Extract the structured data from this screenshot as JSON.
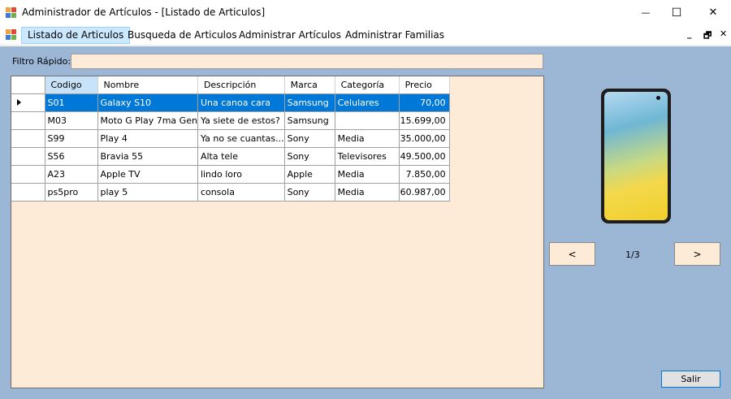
{
  "window": {
    "title": "Administrador de Artículos - [Listado de Articulos]",
    "minimize_glyph": "—",
    "maximize_glyph": "☐",
    "close_glyph": "✕"
  },
  "menu": {
    "items": [
      "Listado de Articulos",
      "Busqueda de Articulos",
      "Administrar Artículos",
      "Administrar Familias"
    ],
    "active_index": 0,
    "mdi_minimize": "_",
    "mdi_restore": "🗗",
    "mdi_close": "✕"
  },
  "filter": {
    "label": "Filtro Rápido:",
    "value": ""
  },
  "grid": {
    "columns": [
      "Codigo",
      "Nombre",
      "Descripción",
      "Marca",
      "Categoría",
      "Precio"
    ],
    "sorted_column": "Codigo",
    "rows": [
      [
        "S01",
        "Galaxy S10",
        "Una canoa cara",
        "Samsung",
        "Celulares",
        "70,00"
      ],
      [
        "M03",
        "Moto G Play 7ma Gen",
        "Ya siete de estos?",
        "Samsung",
        "",
        "15.699,00"
      ],
      [
        "S99",
        "Play 4",
        "Ya no se cuantas...",
        "Sony",
        "Media",
        "35.000,00"
      ],
      [
        "S56",
        "Bravia 55",
        "Alta tele",
        "Sony",
        "Televisores",
        "49.500,00"
      ],
      [
        "A23",
        "Apple TV",
        "lindo loro",
        "Apple",
        "Media",
        "7.850,00"
      ],
      [
        "ps5pro",
        "play 5",
        "consola",
        "Sony",
        "Media",
        "60.987,00"
      ]
    ],
    "selected_row": 0
  },
  "preview": {
    "prev_label": "<",
    "next_label": ">",
    "page_indicator": "1/3"
  },
  "footer": {
    "exit_label": "Salir"
  },
  "colors": {
    "client_bg": "#9cb6d5",
    "grid_bg": "#fdebd7",
    "selection": "#0078d7"
  }
}
